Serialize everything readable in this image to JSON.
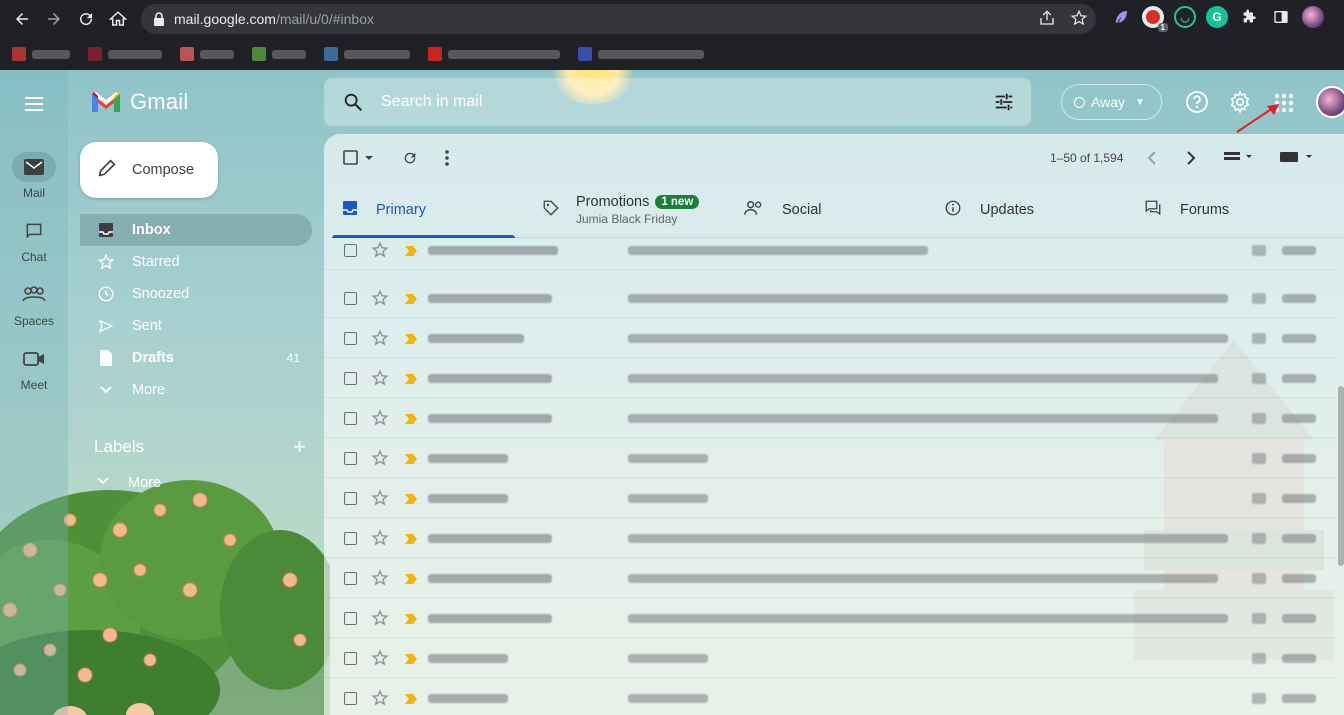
{
  "browser": {
    "url_main": "mail.google.com",
    "url_path": "/mail/u/0/#inbox",
    "extension_badge": "1"
  },
  "gmail": {
    "brand": "Gmail",
    "search_placeholder": "Search in mail",
    "status": "Away",
    "compose_label": "Compose",
    "rail": [
      {
        "label": "Mail"
      },
      {
        "label": "Chat"
      },
      {
        "label": "Spaces"
      },
      {
        "label": "Meet"
      }
    ],
    "nav": [
      {
        "label": "Inbox",
        "count": ""
      },
      {
        "label": "Starred",
        "count": ""
      },
      {
        "label": "Snoozed",
        "count": ""
      },
      {
        "label": "Sent",
        "count": ""
      },
      {
        "label": "Drafts",
        "count": "41"
      },
      {
        "label": "More",
        "count": ""
      }
    ],
    "labels_heading": "Labels",
    "labels_more": "More",
    "pager": "1–50 of 1,594",
    "tabs": [
      {
        "label": "Primary"
      },
      {
        "label": "Promotions",
        "badge": "1 new",
        "subtitle": "Jumia Black Friday"
      },
      {
        "label": "Social"
      },
      {
        "label": "Updates"
      },
      {
        "label": "Forums"
      }
    ],
    "accent": "#1a57c8",
    "important_color": "#f4b400"
  }
}
